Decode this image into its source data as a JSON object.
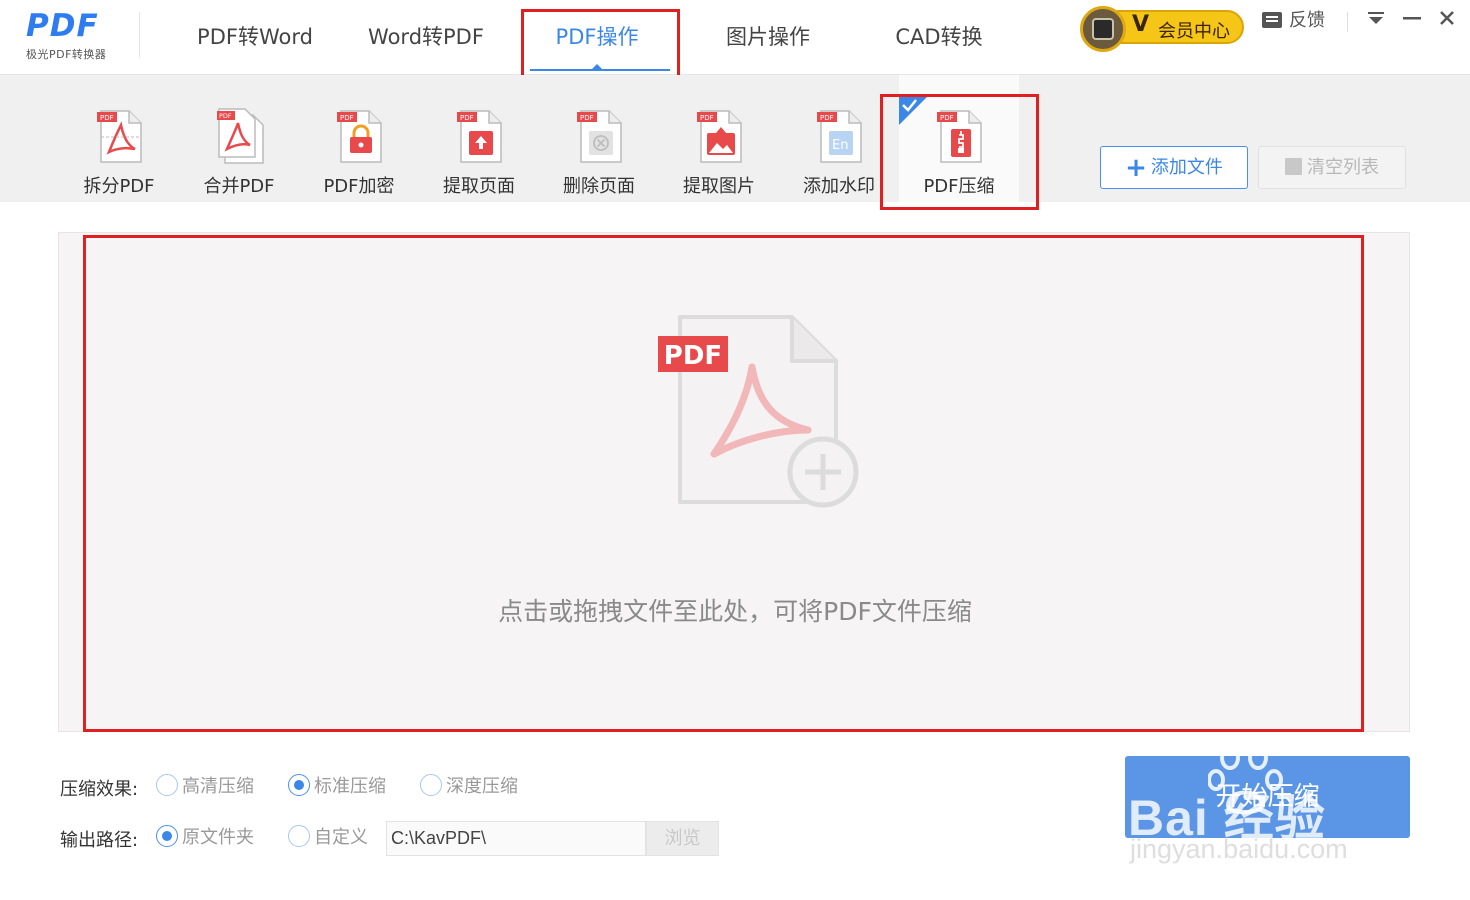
{
  "app": {
    "logo_mark": "PDF",
    "logo_sub": "极光PDF转换器"
  },
  "nav": {
    "tabs": [
      {
        "label": "PDF转Word",
        "active": false
      },
      {
        "label": "Word转PDF",
        "active": false
      },
      {
        "label": "PDF操作",
        "active": true
      },
      {
        "label": "图片操作",
        "active": false
      },
      {
        "label": "CAD转换",
        "active": false
      }
    ],
    "vip_label": "会员中心",
    "vip_badge": "V",
    "feedback_label": "反馈"
  },
  "toolbar": {
    "tools": [
      {
        "label": "拆分PDF",
        "icon": "split-pdf-icon"
      },
      {
        "label": "合并PDF",
        "icon": "merge-pdf-icon"
      },
      {
        "label": "PDF加密",
        "icon": "encrypt-pdf-icon"
      },
      {
        "label": "提取页面",
        "icon": "extract-page-icon"
      },
      {
        "label": "删除页面",
        "icon": "delete-page-icon"
      },
      {
        "label": "提取图片",
        "icon": "extract-image-icon"
      },
      {
        "label": "添加水印",
        "icon": "add-watermark-icon"
      },
      {
        "label": "PDF压缩",
        "icon": "compress-pdf-icon",
        "active": true
      }
    ],
    "add_file_label": "添加文件",
    "clear_list_label": "清空列表"
  },
  "dropzone": {
    "badge": "PDF",
    "hint": "点击或拖拽文件至此处，可将PDF文件压缩"
  },
  "options": {
    "compress_label": "压缩效果:",
    "compress_modes": [
      {
        "label": "高清压缩",
        "checked": false
      },
      {
        "label": "标准压缩",
        "checked": true
      },
      {
        "label": "深度压缩",
        "checked": false
      }
    ],
    "output_label": "输出路径:",
    "output_modes": [
      {
        "label": "原文件夹",
        "checked": true
      },
      {
        "label": "自定义",
        "checked": false
      }
    ],
    "output_path": "C:\\KavPDF\\",
    "browse_label": "浏览"
  },
  "start_button_label": "开始压缩",
  "watermark": {
    "brand": "Bai  经验",
    "url": "jingyan.baidu.com"
  },
  "colors": {
    "accent": "#3a87e8",
    "highlight_box": "#e02020",
    "pdf_red": "#e8494b",
    "vip_gold": "#f5c518"
  }
}
